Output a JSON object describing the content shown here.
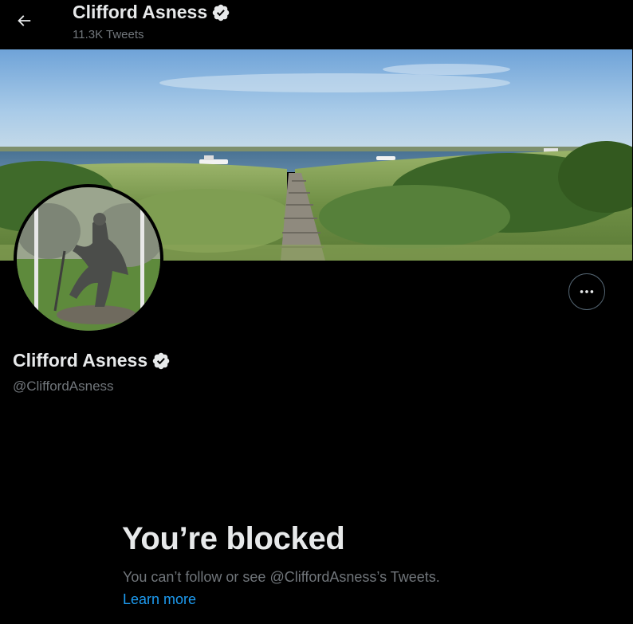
{
  "header": {
    "back_icon": "arrow-left-icon",
    "name": "Clifford Asness",
    "tweet_count": "11.3K Tweets"
  },
  "profile": {
    "name": "Clifford Asness",
    "handle": "@CliffordAsness",
    "verified_icon": "verified-badge-icon",
    "more_icon": "more-horizontal-icon"
  },
  "blocked": {
    "title": "You’re blocked",
    "description": "You can’t follow or see @CliffordAsness’s Tweets.",
    "link": "Learn more"
  },
  "colors": {
    "background": "#000000",
    "text_primary": "#e7e9ea",
    "text_secondary": "#71767b",
    "link": "#1d9bf0"
  }
}
